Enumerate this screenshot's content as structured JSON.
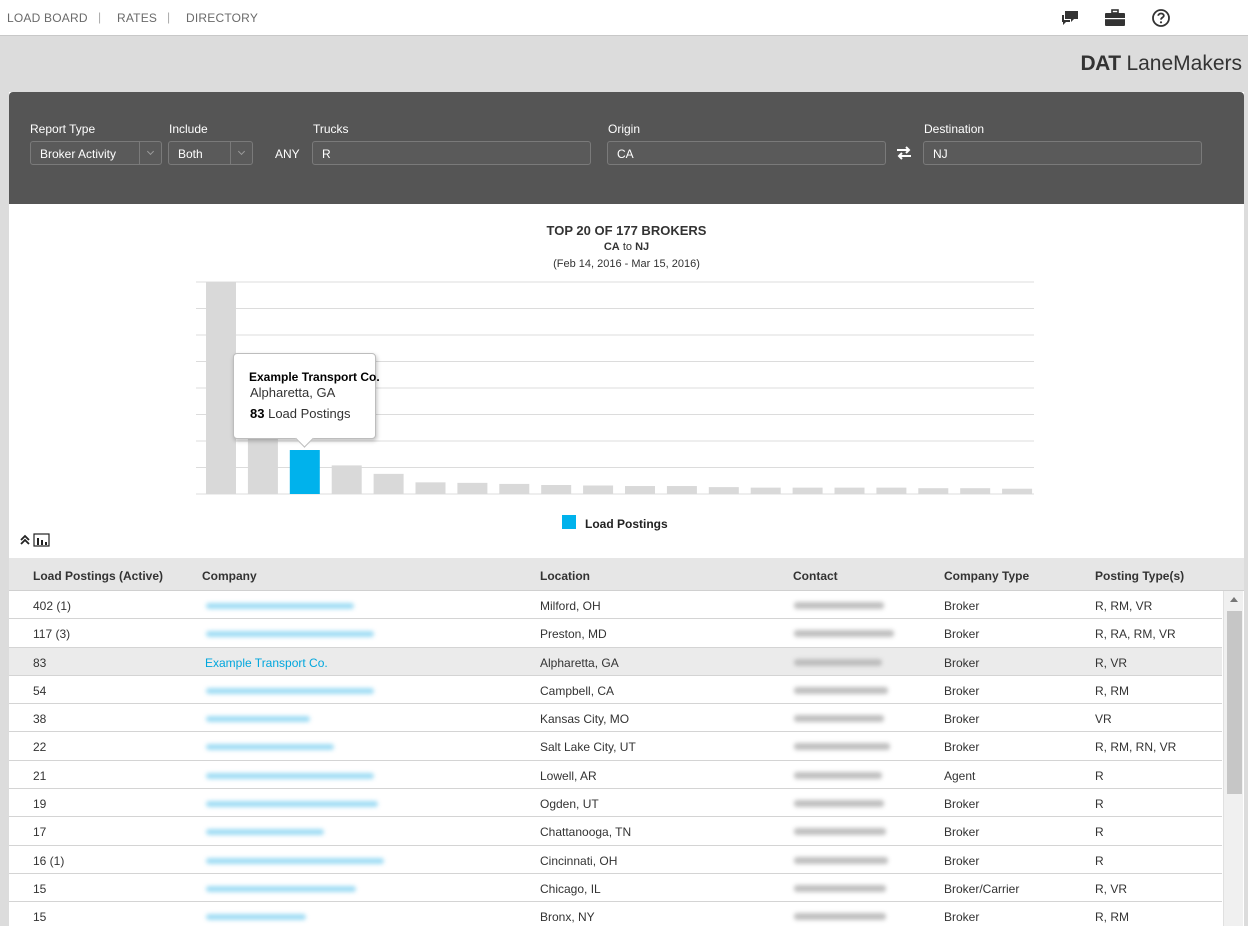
{
  "nav": {
    "load_board": "LOAD BOARD",
    "sep": "|",
    "rates": "RATES",
    "directory": "DIRECTORY",
    "icons": [
      "chat-icon",
      "briefcase-icon",
      "help-icon"
    ]
  },
  "brand": {
    "bold": "DAT",
    "light": "LaneMakers"
  },
  "filters": {
    "report_type": {
      "label": "Report Type",
      "value": "Broker Activity"
    },
    "include": {
      "label": "Include",
      "value": "Both"
    },
    "any_label": "ANY",
    "trucks": {
      "label": "Trucks",
      "value": "R"
    },
    "origin": {
      "label": "Origin",
      "value": "CA"
    },
    "destination": {
      "label": "Destination",
      "value": "NJ"
    }
  },
  "chart_header": {
    "title": "TOP 20 OF 177 BROKERS",
    "origin": "CA",
    "to": "to",
    "destination": "NJ",
    "dates": "(Feb 14, 2016 - Mar 15, 2016)"
  },
  "tooltip": {
    "company": "Example Transport Co.",
    "location": "Alpharetta, GA",
    "count": "83",
    "count_suffix": "Load Postings"
  },
  "chart_data": {
    "type": "bar",
    "title": "TOP 20 OF 177 BROKERS",
    "xlabel": "",
    "ylabel": "",
    "ylim": [
      0,
      400
    ],
    "grid": true,
    "legend": "bottom",
    "highlight_index": 2,
    "series": [
      {
        "name": "Load Postings",
        "values": [
          402,
          117,
          83,
          54,
          38,
          22,
          21,
          19,
          17,
          16,
          15,
          15,
          13,
          12,
          12,
          12,
          12,
          11,
          11,
          10
        ]
      }
    ]
  },
  "colors": {
    "bar": "#d9d9d9",
    "highlight": "#00b2ec",
    "filter_bg": "#555555",
    "link": "#00a6dd"
  },
  "table": {
    "headers": [
      "Load Postings (Active)",
      "Company",
      "Location",
      "Contact",
      "Company Type",
      "Posting Type(s)"
    ],
    "rows": [
      {
        "postings": "402 (1)",
        "company": "",
        "location": "Milford, OH",
        "type": "Broker",
        "posting_types": "R, RM, VR"
      },
      {
        "postings": "117 (3)",
        "company": "",
        "location": "Preston, MD",
        "type": "Broker",
        "posting_types": "R, RA, RM, VR"
      },
      {
        "postings": "83",
        "company": "Example Transport Co.",
        "location": "Alpharetta, GA",
        "type": "Broker",
        "posting_types": "R, VR",
        "selected": true
      },
      {
        "postings": "54",
        "company": "",
        "location": "Campbell, CA",
        "type": "Broker",
        "posting_types": "R, RM"
      },
      {
        "postings": "38",
        "company": "",
        "location": "Kansas City, MO",
        "type": "Broker",
        "posting_types": "VR"
      },
      {
        "postings": "22",
        "company": "",
        "location": "Salt Lake City, UT",
        "type": "Broker",
        "posting_types": "R, RM, RN, VR"
      },
      {
        "postings": "21",
        "company": "",
        "location": "Lowell, AR",
        "type": "Agent",
        "posting_types": "R"
      },
      {
        "postings": "19",
        "company": "",
        "location": "Ogden, UT",
        "type": "Broker",
        "posting_types": "R"
      },
      {
        "postings": "17",
        "company": "",
        "location": "Chattanooga, TN",
        "type": "Broker",
        "posting_types": "R"
      },
      {
        "postings": "16 (1)",
        "company": "",
        "location": "Cincinnati, OH",
        "type": "Broker",
        "posting_types": "R"
      },
      {
        "postings": "15",
        "company": "",
        "location": "Chicago, IL",
        "type": "Broker/Carrier",
        "posting_types": "R, VR"
      },
      {
        "postings": "15",
        "company": "",
        "location": "Bronx, NY",
        "type": "Broker",
        "posting_types": "R, RM"
      }
    ]
  }
}
